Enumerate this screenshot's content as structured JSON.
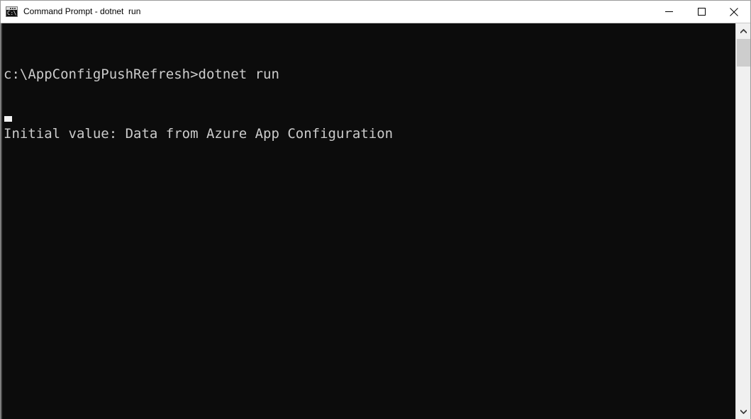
{
  "window": {
    "title": "Command Prompt - dotnet  run",
    "icon": "cmd-icon",
    "icon_text": "C:\\",
    "colors": {
      "console_background": "#0c0c0c",
      "console_foreground": "#cccccc",
      "titlebar_background": "#ffffff",
      "titlebar_foreground": "#000000",
      "scrollbar_track": "#f0f0f0",
      "scrollbar_thumb": "#cdcdcd",
      "window_border": "#9a9a9a"
    },
    "caption_buttons": [
      {
        "name": "minimize",
        "glyph": "minimize-icon"
      },
      {
        "name": "maximize",
        "glyph": "maximize-icon"
      },
      {
        "name": "close",
        "glyph": "close-icon"
      }
    ]
  },
  "console": {
    "lines": [
      "c:\\AppConfigPushRefresh>dotnet run",
      "Initial value: Data from Azure App Configuration"
    ],
    "prompt": "c:\\AppConfigPushRefresh>",
    "command": "dotnet run",
    "output": "Initial value: Data from Azure App Configuration",
    "cursor_line": 3,
    "cursor_column": 1
  },
  "scrollbar": {
    "up_arrow": "chevron-up-icon",
    "down_arrow": "chevron-down-icon",
    "thumb_position_percent": 0
  }
}
